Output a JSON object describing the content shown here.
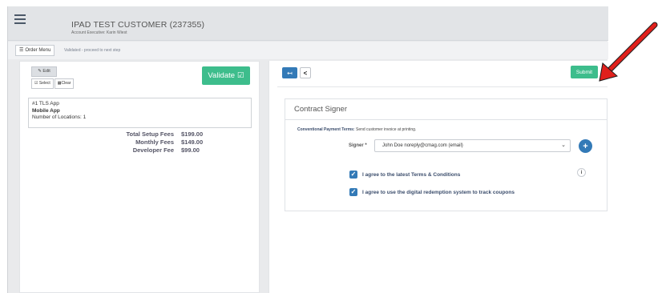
{
  "header": {
    "customer_title": "IPAD TEST CUSTOMER (237355)",
    "account_exec": "Account Executive: Karin Wiest"
  },
  "subbar": {
    "order_menu_label": "Order Menu",
    "status_message": "Validated - proceed to next step"
  },
  "left_panel": {
    "edit_label": "Edit",
    "select_label": "Select",
    "clear_label": "Clear",
    "validate_label": "Validate",
    "product": {
      "line1": "#1 TLS App",
      "line2": "Mobile App",
      "line3": "Number of Locations: 1"
    },
    "fees": [
      {
        "label": "Total Setup Fees",
        "value": "$199.00"
      },
      {
        "label": "Monthly Fees",
        "value": "$149.00"
      },
      {
        "label": "Developer Fee",
        "value": "$99.00"
      }
    ]
  },
  "right_panel": {
    "back_icon": "↤",
    "chevron_icon": "<",
    "submit_label": "Submit",
    "contract_title": "Contract Signer",
    "payment_terms_label": "Conventional Payment Terms:",
    "payment_terms_value": "Send customer invoice at printing.",
    "signer_label": "Signer *",
    "signer_value": "John Doe noreply@cmag.com (email)",
    "agree_terms": "I agree to the latest Terms & Conditions",
    "agree_digital": "I agree to use the digital redemption system to track coupons"
  },
  "icons": {
    "menu": "hamburger-icon",
    "list": "list-icon",
    "edit": "pencil-icon",
    "check": "check-icon",
    "info": "info-icon",
    "plus": "plus-icon",
    "arrow": "red-arrow-annotation"
  },
  "colors": {
    "accent_green": "#3dbd8c",
    "accent_blue": "#337ab7",
    "arrow_red": "#e0201c"
  }
}
